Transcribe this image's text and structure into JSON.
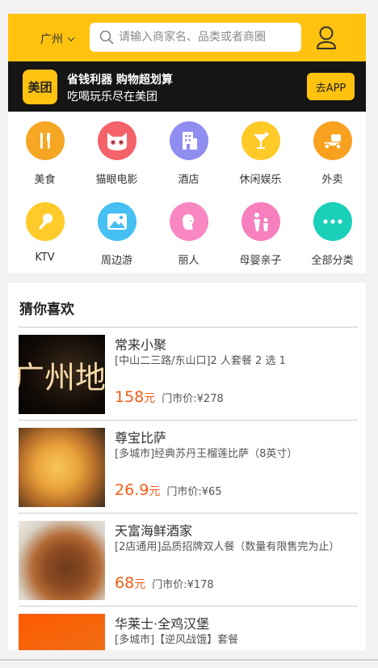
{
  "header": {
    "city": "广州",
    "search_placeholder": "请输入商家名、品类或者商圈"
  },
  "banner": {
    "logo_text": "美团",
    "line1": "省钱利器 购物超划算",
    "line2": "吃喝玩乐尽在美团",
    "button_label": "去APP"
  },
  "categories": [
    {
      "label": "美食",
      "color": "#f5a623",
      "icon": "fork-knife-icon"
    },
    {
      "label": "猫眼电影",
      "color": "#f4626a",
      "icon": "cat-icon"
    },
    {
      "label": "酒店",
      "color": "#8f8ef0",
      "icon": "building-icon"
    },
    {
      "label": "休闲娱乐",
      "color": "#ffc928",
      "icon": "cocktail-icon"
    },
    {
      "label": "外卖",
      "color": "#f7a11e",
      "icon": "scooter-icon"
    },
    {
      "label": "KTV",
      "color": "#ffcb2b",
      "icon": "microphone-icon"
    },
    {
      "label": "周边游",
      "color": "#46c0f2",
      "icon": "landscape-icon"
    },
    {
      "label": "丽人",
      "color": "#f887c2",
      "icon": "woman-icon"
    },
    {
      "label": "母婴亲子",
      "color": "#f67fbd",
      "icon": "family-icon"
    },
    {
      "label": "全部分类",
      "color": "#1ad0b8",
      "icon": "more-icon"
    }
  ],
  "section_title": "猜你喜欢",
  "deals": [
    {
      "name": "常来小聚",
      "desc": "[中山二三路/东山口]2 人套餐 2 选 1",
      "price": "158",
      "unit": "元",
      "market_price": "门市价:¥278",
      "thumb_text": "广州地"
    },
    {
      "name": "尊宝比萨",
      "desc": "[多城市]经典苏丹王榴莲比萨（8英寸）",
      "price": "26.9",
      "unit": "元",
      "market_price": "门市价:¥65"
    },
    {
      "name": "天富海鲜酒家",
      "desc": "[2店通用]品质招牌双人餐（数量有限售完为止）",
      "price": "68",
      "unit": "元",
      "market_price": "门市价:¥178"
    },
    {
      "name": "华莱士·全鸡汉堡",
      "desc": "[多城市]【逆风战饿】套餐",
      "price": "",
      "unit": "",
      "market_price": ""
    }
  ]
}
